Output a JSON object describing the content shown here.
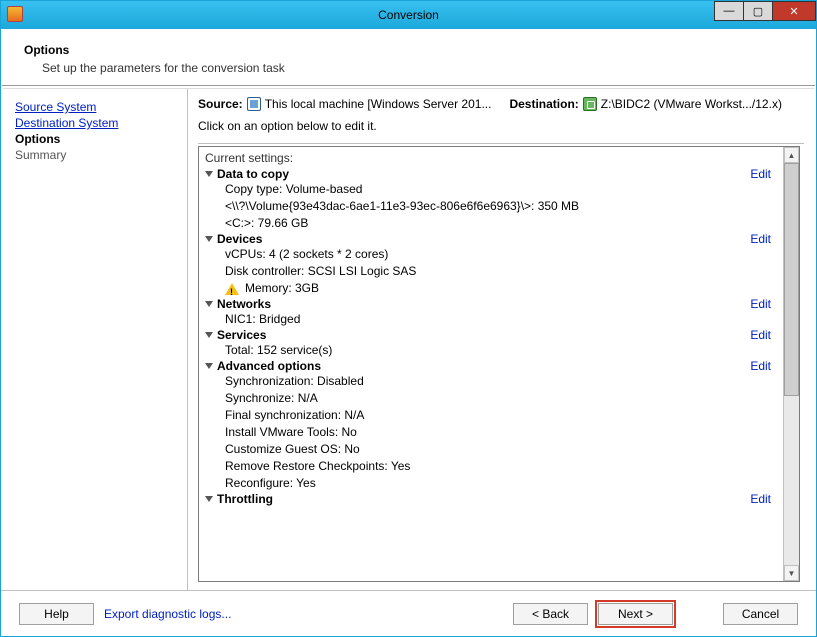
{
  "window": {
    "title": "Conversion",
    "minimize": "—",
    "maximize": "▢",
    "close": "✕"
  },
  "header": {
    "title": "Options",
    "subtitle": "Set up the parameters for the conversion task"
  },
  "sidebar": {
    "steps": [
      {
        "label": "Source System",
        "kind": "link"
      },
      {
        "label": "Destination System",
        "kind": "link"
      },
      {
        "label": "Options",
        "kind": "current"
      },
      {
        "label": "Summary",
        "kind": "pending"
      }
    ]
  },
  "srcdst": {
    "source_label": "Source:",
    "source_value": "This local machine [Windows Server 201...",
    "dest_label": "Destination:",
    "dest_value": "Z:\\BIDC2 (VMware Workst.../12.x)"
  },
  "hint": "Click on an option below to edit it.",
  "current_settings_label": "Current settings:",
  "edit_label": "Edit",
  "sections": [
    {
      "title": "Data to copy",
      "editable": true,
      "items": [
        "Copy type: Volume-based",
        "<\\\\?\\Volume{93e43dac-6ae1-11e3-93ec-806e6f6e6963}\\>: 350 MB",
        "<C:>: 79.66 GB"
      ]
    },
    {
      "title": "Devices",
      "editable": true,
      "items": [
        "vCPUs: 4 (2 sockets * 2 cores)",
        "Disk controller: SCSI LSI Logic SAS",
        {
          "warn": true,
          "text": "Memory: 3GB"
        }
      ]
    },
    {
      "title": "Networks",
      "editable": true,
      "items": [
        "NIC1: Bridged"
      ]
    },
    {
      "title": "Services",
      "editable": true,
      "items": [
        "Total: 152 service(s)"
      ]
    },
    {
      "title": "Advanced options",
      "editable": true,
      "items": [
        "Synchronization: Disabled",
        "Synchronize: N/A",
        "Final synchronization: N/A",
        "Install VMware Tools: No",
        "Customize Guest OS: No",
        "Remove Restore Checkpoints: Yes",
        "Reconfigure: Yes"
      ]
    },
    {
      "title": "Throttling",
      "editable": true,
      "items": []
    }
  ],
  "footer": {
    "help": "Help",
    "export": "Export diagnostic logs...",
    "back": "< Back",
    "next": "Next >",
    "cancel": "Cancel"
  }
}
